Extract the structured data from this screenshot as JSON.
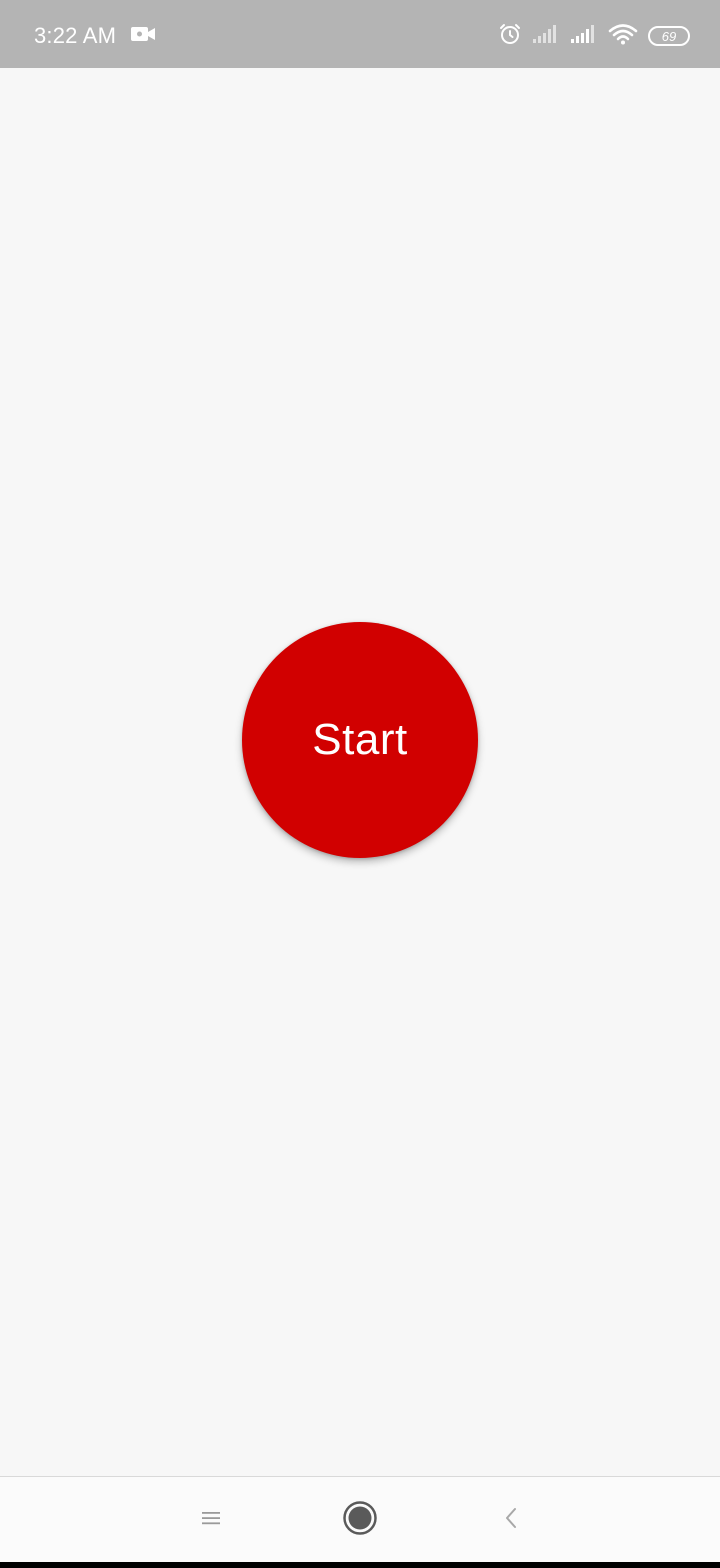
{
  "status_bar": {
    "time": "3:22 AM",
    "battery_level": "69",
    "icons": [
      "video-camera-icon",
      "alarm-icon",
      "signal-sim1-icon",
      "signal-sim2-icon",
      "wifi-icon",
      "battery-icon"
    ],
    "background_color": "#b4b4b4"
  },
  "main": {
    "start_button_label": "Start",
    "accent_color": "#d10000"
  },
  "nav_bar": {
    "buttons": [
      "menu-icon",
      "home-icon",
      "back-icon"
    ]
  }
}
